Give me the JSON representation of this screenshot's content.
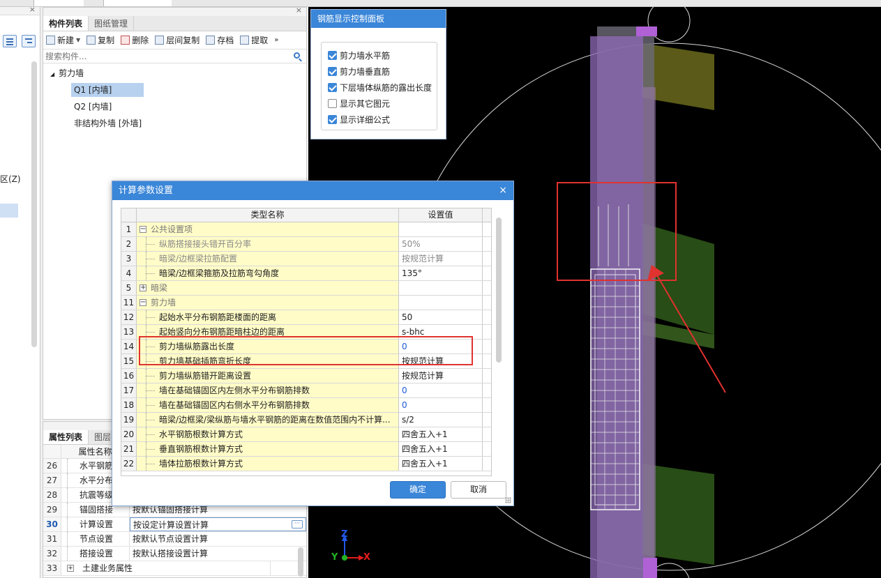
{
  "comp_panel": {
    "tabs": [
      "构件列表",
      "图纸管理"
    ],
    "toolbar": {
      "new": "新建",
      "copy": "复制",
      "delete": "删除",
      "floor_copy": "层间复制",
      "save": "存档",
      "extract": "提取"
    },
    "search_placeholder": "搜索构件...",
    "tree": {
      "root": "剪力墙",
      "items": [
        "Q1 [内墙]",
        "Q2 [内墙]",
        "非结构外墙 [外墙]"
      ]
    }
  },
  "left_panel": {
    "zone_label": "区(Z)"
  },
  "prop_panel": {
    "tabs": [
      "属性列表",
      "图层"
    ],
    "header_name": "属性名称",
    "rows": [
      {
        "num": "26",
        "name": "水平钢筋",
        "value": ""
      },
      {
        "num": "27",
        "name": "水平分布",
        "value": ""
      },
      {
        "num": "28",
        "name": "抗震等级",
        "value": ""
      },
      {
        "num": "29",
        "name": "锚固搭接",
        "value": "按默认锚固搭接计算"
      },
      {
        "num": "30",
        "name": "计算设置",
        "value": "按设定计算设置计算"
      },
      {
        "num": "31",
        "name": "节点设置",
        "value": "按默认节点设置计算"
      },
      {
        "num": "32",
        "name": "搭接设置",
        "value": "按默认搭接设置计算"
      },
      {
        "num": "33",
        "name": "土建业务属性",
        "value": ""
      }
    ],
    "dots": "···"
  },
  "rebar_panel": {
    "title": "钢筋显示控制面板",
    "options": [
      {
        "label": "剪力墙水平筋",
        "checked": true
      },
      {
        "label": "剪力墙垂直筋",
        "checked": true
      },
      {
        "label": "下层墙体纵筋的露出长度",
        "checked": true
      },
      {
        "label": "显示其它图元",
        "checked": false
      },
      {
        "label": "显示详细公式",
        "checked": true
      }
    ]
  },
  "calc_dialog": {
    "title": "计算参数设置",
    "close": "×",
    "col_name": "类型名称",
    "col_value": "设置值",
    "rows": [
      {
        "num": "1",
        "name": "公共设置项",
        "value": "",
        "level": 0,
        "toggle": "−"
      },
      {
        "num": "2",
        "name": "纵筋搭接接头错开百分率",
        "value": "50%",
        "level": 1,
        "gray": true
      },
      {
        "num": "3",
        "name": "暗梁/边框梁拉筋配置",
        "value": "按规范计算",
        "level": 1,
        "gray": true
      },
      {
        "num": "4",
        "name": "暗梁/边框梁箍筋及拉筋弯勾角度",
        "value": "135°",
        "level": 1
      },
      {
        "num": "5",
        "name": "暗梁",
        "value": "",
        "level": 0,
        "toggle": "+"
      },
      {
        "num": "11",
        "name": "剪力墙",
        "value": "",
        "level": 0,
        "toggle": "−"
      },
      {
        "num": "12",
        "name": "起始水平分布钢筋距楼面的距离",
        "value": "50",
        "level": 1
      },
      {
        "num": "13",
        "name": "起始竖向分布钢筋距暗柱边的距离",
        "value": "s-bhc",
        "level": 1
      },
      {
        "num": "14",
        "name": "剪力墙纵筋露出长度",
        "value": "0",
        "level": 1,
        "blue": true
      },
      {
        "num": "15",
        "name": "剪力墙基础插筋弯折长度",
        "value": "按规范计算",
        "level": 1
      },
      {
        "num": "16",
        "name": "剪力墙纵筋错开距离设置",
        "value": "按规范计算",
        "level": 1
      },
      {
        "num": "17",
        "name": "墙在基础锚固区内左侧水平分布钢筋排数",
        "value": "0",
        "level": 1,
        "blue": true
      },
      {
        "num": "18",
        "name": "墙在基础锚固区内右侧水平分布钢筋排数",
        "value": "0",
        "level": 1,
        "blue": true
      },
      {
        "num": "19",
        "name": "暗梁/边框梁/梁纵筋与墙水平钢筋的距离在数值范围内不计算...",
        "value": "s/2",
        "level": 1
      },
      {
        "num": "20",
        "name": "水平钢筋根数计算方式",
        "value": "四舍五入+1",
        "level": 1
      },
      {
        "num": "21",
        "name": "垂直钢筋根数计算方式",
        "value": "四舍五入+1",
        "level": 1
      },
      {
        "num": "22",
        "name": "墙体拉筋根数计算方式",
        "value": "四舍五入+1",
        "level": 1
      }
    ],
    "ok": "确定",
    "cancel": "取消"
  },
  "viewport": {
    "axes": {
      "x": "X",
      "y": "Y",
      "z": "Z"
    },
    "colors": {
      "wall": "#8f6bb8",
      "beam_top": "#6b6a1c",
      "beam_green": "#2f5a1a",
      "red_mark": "#e0322f",
      "axis_x": "#e21b1b",
      "axis_y": "#22b322",
      "axis_z": "#2357e6"
    }
  }
}
